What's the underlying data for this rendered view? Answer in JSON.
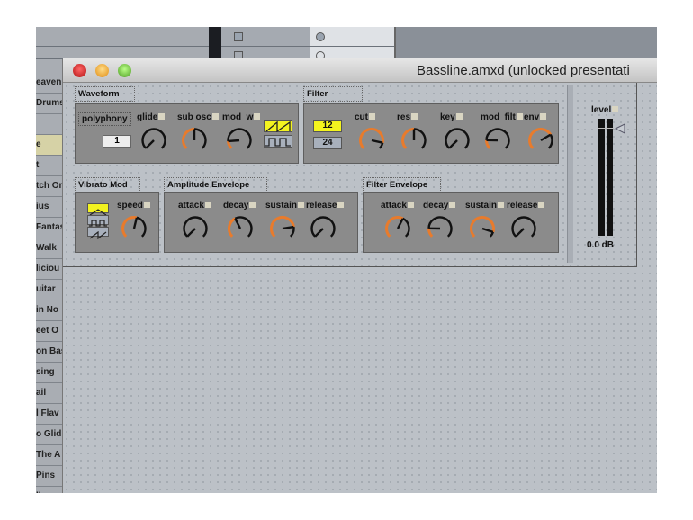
{
  "window": {
    "title": "Bassline.amxd (unlocked presentati"
  },
  "sidebar": {
    "items": [
      "eaven",
      "Drums",
      "",
      "e",
      "t",
      "tch Or",
      "ius",
      "Fantas",
      "Walk",
      "liciou",
      "uitar",
      "in No",
      "eet O",
      "on Bas",
      "sing",
      "ail",
      "l Flav",
      "o Glid",
      "The A",
      "Pins",
      "ll"
    ],
    "selected_index": 3
  },
  "waveform": {
    "title": "Waveform",
    "polyphony_label": "polyphony",
    "polyphony_value": "1",
    "knobs": [
      {
        "label": "glide",
        "value": 0.0
      },
      {
        "label": "sub osc",
        "value": 0.5
      },
      {
        "label": "mod_w",
        "value": 0.15
      }
    ],
    "wave_buttons": [
      {
        "icon": "saw-wave-icon",
        "active": true
      },
      {
        "icon": "square-wave-icon",
        "active": false
      }
    ]
  },
  "filter": {
    "title": "Filter",
    "slope_buttons": [
      {
        "label": "12",
        "active": true
      },
      {
        "label": "24",
        "active": false
      }
    ],
    "knobs": [
      {
        "label": "cut",
        "value": 0.88
      },
      {
        "label": "res",
        "value": 0.5
      },
      {
        "label": "key",
        "value": 0.0
      },
      {
        "label": "mod_filt",
        "value": 0.17
      },
      {
        "label": "env",
        "value": 0.72
      }
    ]
  },
  "vibrato": {
    "title": "Vibrato Mod",
    "wave_buttons": [
      {
        "icon": "triangle-wave-icon",
        "active": true
      },
      {
        "icon": "square-wave-icon",
        "active": false
      },
      {
        "icon": "saw-wave-icon",
        "active": false
      }
    ],
    "knobs": [
      {
        "label": "speed",
        "value": 0.55
      }
    ]
  },
  "amp_env": {
    "title": "Amplitude Envelope",
    "knobs": [
      {
        "label": "attack",
        "value": 0.0
      },
      {
        "label": "decay",
        "value": 0.4
      },
      {
        "label": "sustain",
        "value": 0.8
      },
      {
        "label": "release",
        "value": 0.0
      }
    ]
  },
  "filter_env": {
    "title": "Filter Envelope",
    "knobs": [
      {
        "label": "attack",
        "value": 0.6
      },
      {
        "label": "decay",
        "value": 0.17
      },
      {
        "label": "sustain",
        "value": 0.9
      },
      {
        "label": "release",
        "value": 0.0
      }
    ]
  },
  "level": {
    "label": "level",
    "readout": "0.0 dB",
    "value": 0.92
  },
  "colors": {
    "accent": "#e87b2c",
    "active": "#f3f320"
  }
}
